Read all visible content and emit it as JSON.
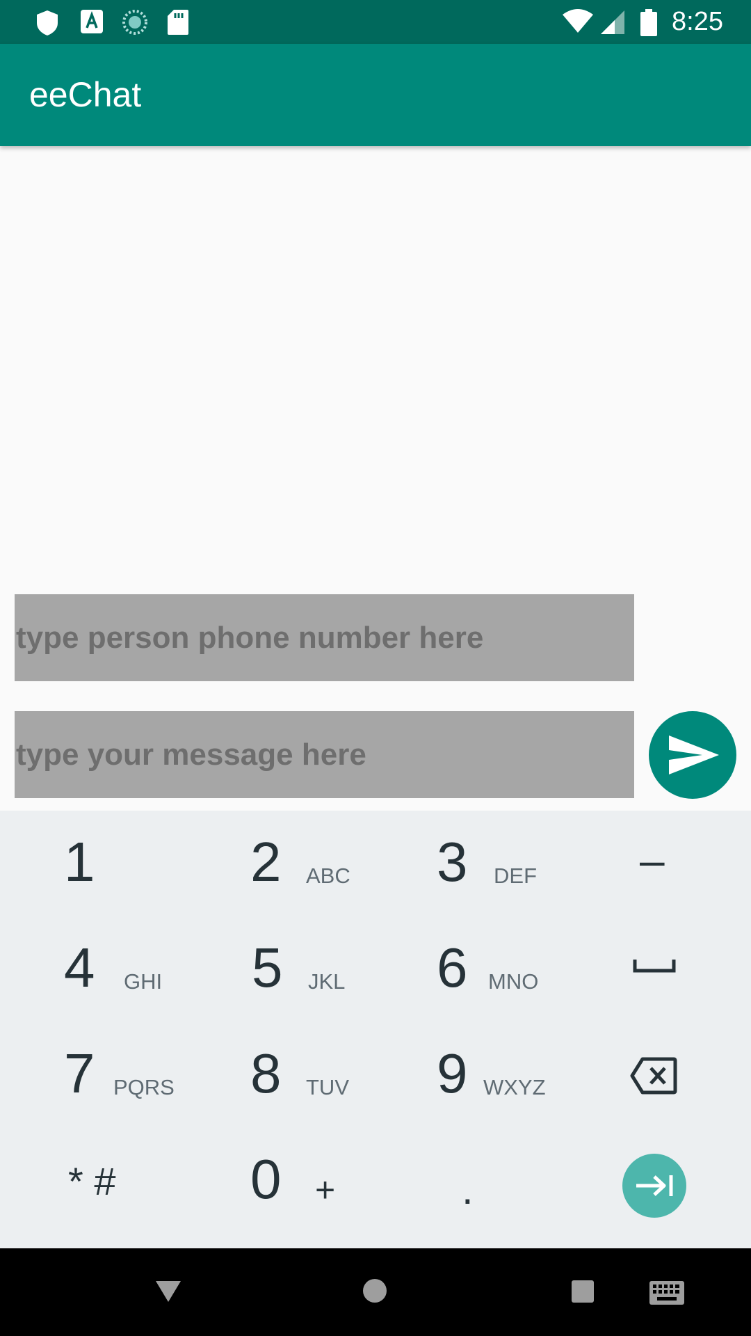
{
  "status_bar": {
    "time": "8:25",
    "left_icons": [
      "shield-icon",
      "font-a-icon",
      "sync-icon",
      "sd-card-icon"
    ],
    "right_icons": [
      "wifi-icon",
      "signal-icon",
      "battery-icon"
    ]
  },
  "app_bar": {
    "title": "eeChat"
  },
  "form": {
    "phone_placeholder": "type person phone number here",
    "message_placeholder": "type your message here",
    "send_icon": "send-icon"
  },
  "keyboard": {
    "keys": [
      {
        "num": "1",
        "letters": ""
      },
      {
        "num": "2",
        "letters": "ABC"
      },
      {
        "num": "3",
        "letters": "DEF"
      },
      {
        "num": "4",
        "letters": "GHI"
      },
      {
        "num": "5",
        "letters": "JKL"
      },
      {
        "num": "6",
        "letters": "MNO"
      },
      {
        "num": "7",
        "letters": "PQRS"
      },
      {
        "num": "8",
        "letters": "TUV"
      },
      {
        "num": "9",
        "letters": "WXYZ"
      },
      {
        "num": "0",
        "letters": "+"
      }
    ],
    "star_hash": "* #",
    "dash": "–",
    "dot": ".",
    "special_icons": [
      "space-icon",
      "backspace-icon",
      "tab-next-icon"
    ]
  },
  "nav_bar": {
    "icons": [
      "back-icon",
      "home-icon",
      "recents-icon",
      "keyboard-switch-icon"
    ]
  },
  "colors": {
    "status_bar": "#00695c",
    "app_bar": "#00897b",
    "field_bg": "#a6a6a6",
    "send_button": "#00897b",
    "keyboard_bg": "#eceff1",
    "tab_key": "#4db6ac"
  }
}
